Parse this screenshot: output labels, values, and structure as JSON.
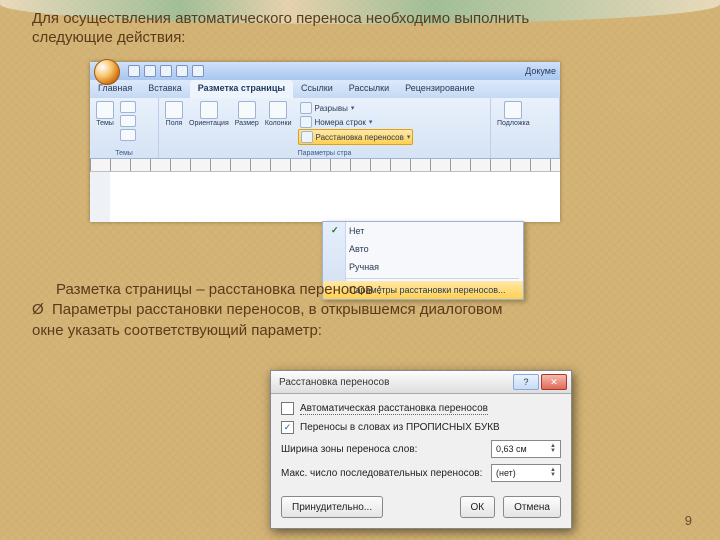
{
  "intro": {
    "line1": "Для осуществления автоматического переноса необходимо выполнить",
    "line2": "следующие действия:"
  },
  "para2": {
    "line1": "Разметка страницы – расстановка переносов :",
    "bullet_symbol": "Ø",
    "bullet_text": "Параметры расстановки переносов, в открывшемся диалоговом",
    "line3": "окне указать соответствующий параметр:"
  },
  "page_number": "9",
  "word": {
    "doc_title": "Докуме",
    "tabs": {
      "home": "Главная",
      "insert": "Вставка",
      "layout": "Разметка страницы",
      "refs": "Ссылки",
      "mail": "Рассылки",
      "review": "Рецензирование"
    },
    "groups": {
      "themes": "Темы",
      "themes_btn": "Темы",
      "page_params_label": "Параметры стра",
      "margins": "Поля",
      "orientation": "Ориентация",
      "size": "Размер",
      "columns": "Колонки",
      "breaks": "Разрывы",
      "line_numbers": "Номера строк",
      "hyphenation": "Расстановка переносов",
      "watermark": "Подложка"
    },
    "dropdown": {
      "none": "Нет",
      "auto": "Авто",
      "manual": "Ручная",
      "options": "Параметры расстановки переносов..."
    }
  },
  "dialog": {
    "title": "Расстановка переносов",
    "help_symbol": "?",
    "close_symbol": "✕",
    "chk_auto": "Автоматическая расстановка переносов",
    "chk_caps": "Переносы в словах из ПРОПИСНЫХ БУКВ",
    "zone_label": "Ширина зоны переноса слов:",
    "zone_value": "0,63 см",
    "max_label": "Макс. число последовательных переносов:",
    "max_value": "(нет)",
    "btn_force": "Принудительно...",
    "btn_ok": "ОК",
    "btn_cancel": "Отмена"
  }
}
